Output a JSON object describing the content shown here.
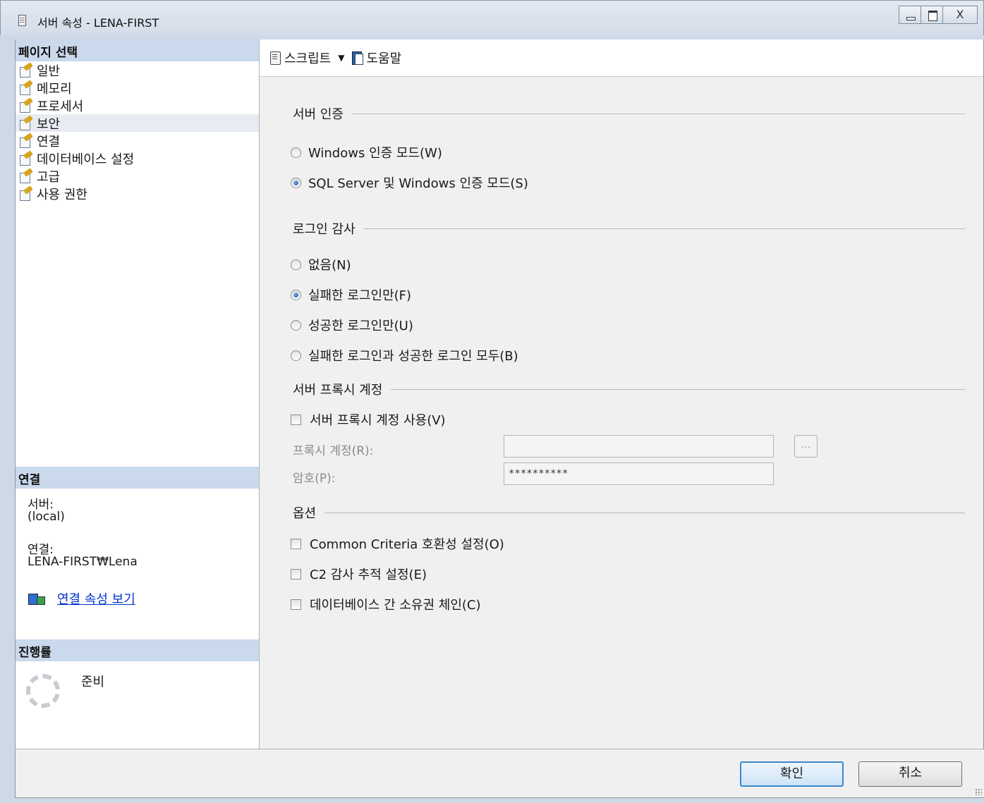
{
  "window": {
    "title": "서버 속성 - LENA-FIRST",
    "close_glyph": "X"
  },
  "left": {
    "page_select_header": "페이지 선택",
    "pages": [
      "일반",
      "메모리",
      "프로세서",
      "보안",
      "연결",
      "데이터베이스 설정",
      "고급",
      "사용 권한"
    ],
    "selected_page": "보안",
    "connection_header": "연결",
    "server_label": "서버:",
    "server_value": "(local)",
    "connection_label": "연결:",
    "connection_value": "LENA-FIRST₩Lena",
    "view_connection_link": "연결 속성 보기",
    "progress_header": "진행률",
    "progress_status": "준비"
  },
  "toolbar": {
    "script_label": "스크립트",
    "dropdown_glyph": "▼",
    "help_label": "도움말"
  },
  "auth": {
    "title": "서버 인증",
    "windows_mode": "Windows 인증 모드(W)",
    "mixed_mode": "SQL Server 및 Windows 인증 모드(S)",
    "selected": "mixed_mode"
  },
  "login_audit": {
    "title": "로그인 감사",
    "none": "없음(N)",
    "failed_only": "실패한 로그인만(F)",
    "success_only": "성공한 로그인만(U)",
    "both": "실패한 로그인과 성공한 로그인 모두(B)",
    "selected": "failed_only"
  },
  "proxy": {
    "title": "서버 프록시 계정",
    "enable_label": "서버 프록시 계정 사용(V)",
    "enable_checked": false,
    "account_label": "프록시 계정(R):",
    "account_value": "",
    "browse_label": "...",
    "password_label": "암호(P):",
    "password_value": "**********"
  },
  "options": {
    "title": "옵션",
    "common_criteria": "Common Criteria 호환성 설정(O)",
    "c2_audit": "C2 감사 추적 설정(E)",
    "cross_db_chaining": "데이터베이스 간 소유권 체인(C)"
  },
  "buttons": {
    "ok": "확인",
    "cancel": "취소"
  }
}
